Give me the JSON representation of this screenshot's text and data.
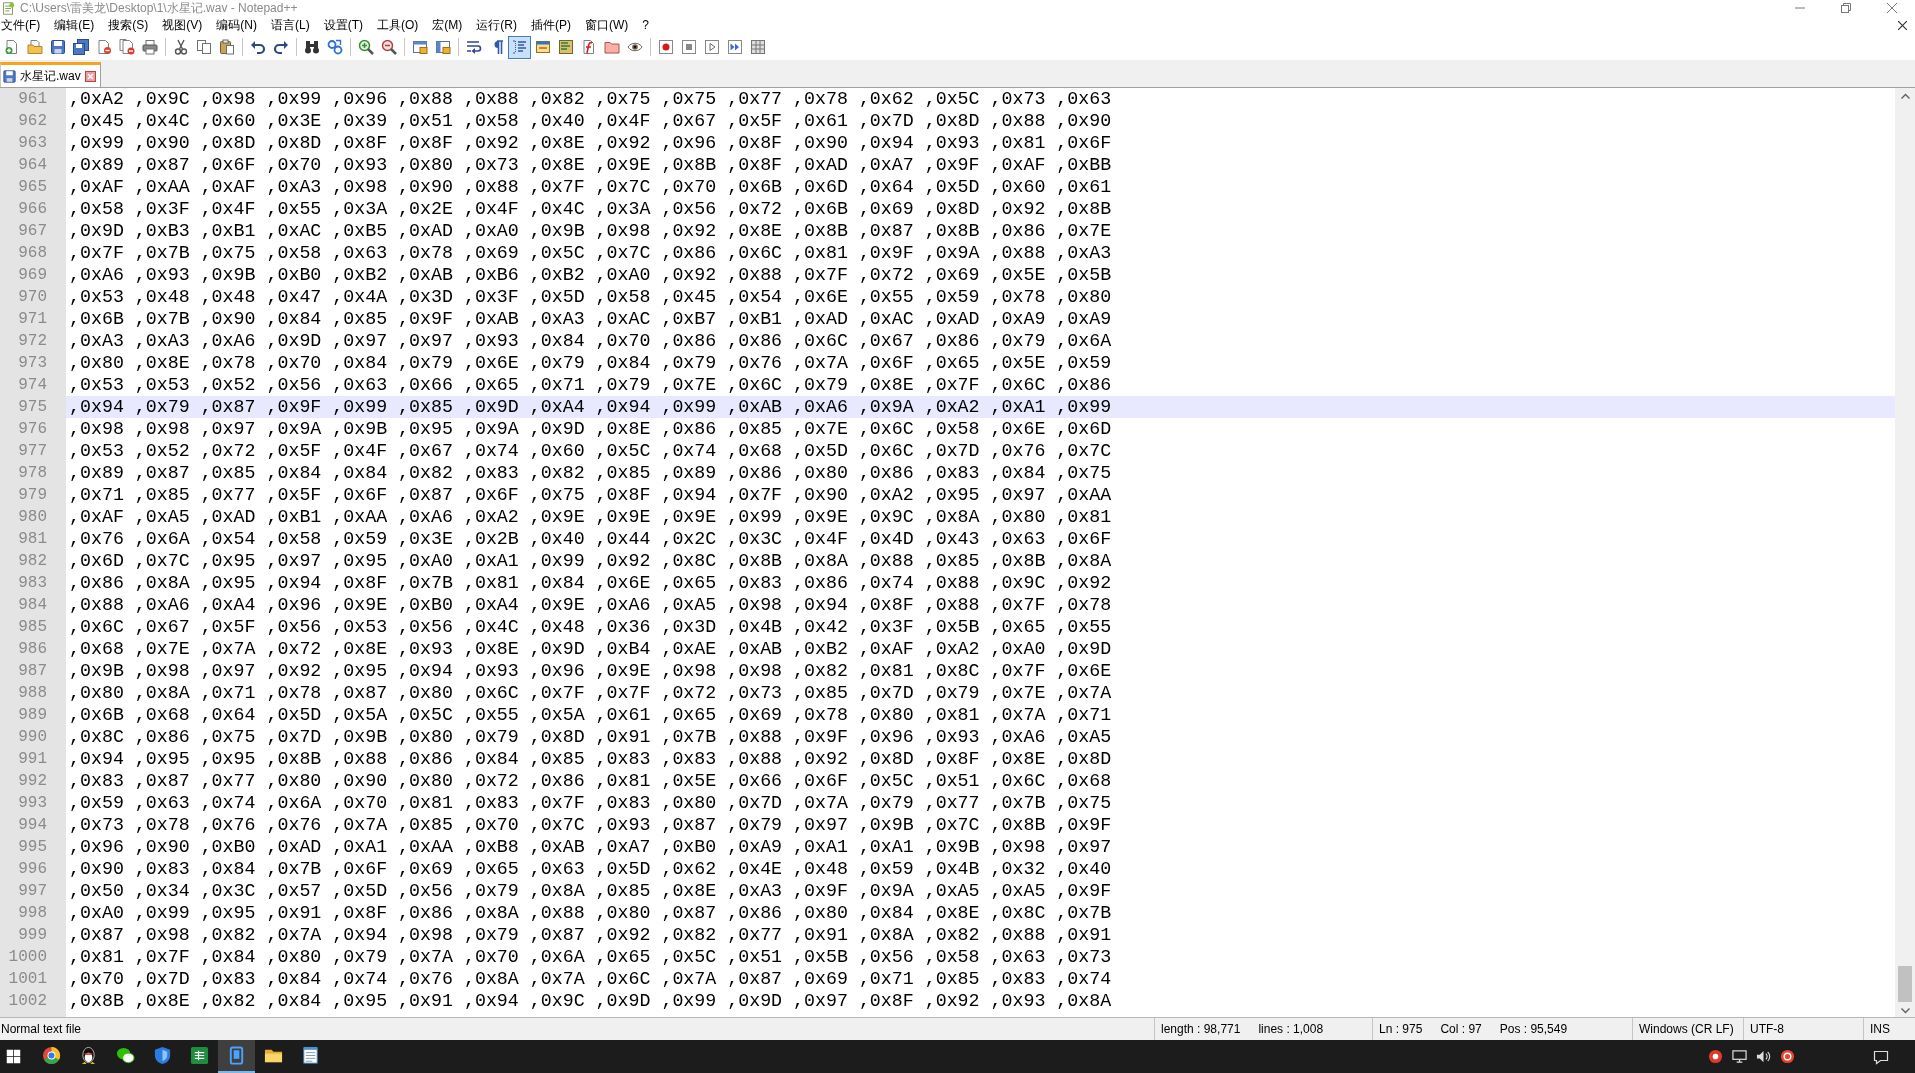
{
  "window": {
    "title": "C:\\Users\\雷美龙\\Desktop\\1\\水星记.wav - Notepad++"
  },
  "menu": [
    "文件(F)",
    "编辑(E)",
    "搜索(S)",
    "视图(V)",
    "编码(N)",
    "语言(L)",
    "设置(T)",
    "工具(O)",
    "宏(M)",
    "运行(R)",
    "插件(P)",
    "窗口(W)",
    "?"
  ],
  "toolbar": [
    [
      {
        "kind": "new",
        "on": false
      },
      {
        "kind": "open",
        "on": false
      },
      {
        "kind": "save",
        "on": false
      },
      {
        "kind": "saveall",
        "on": false
      },
      {
        "kind": "close",
        "on": false
      },
      {
        "kind": "closeall",
        "on": false
      },
      {
        "kind": "print",
        "on": false
      }
    ],
    [
      {
        "kind": "cut",
        "on": false
      },
      {
        "kind": "copy",
        "on": false
      },
      {
        "kind": "paste",
        "on": false
      }
    ],
    [
      {
        "kind": "undo",
        "on": false
      },
      {
        "kind": "redo",
        "on": false
      }
    ],
    [
      {
        "kind": "find",
        "on": false
      },
      {
        "kind": "replace",
        "on": false
      }
    ],
    [
      {
        "kind": "zoomin",
        "on": false
      },
      {
        "kind": "zoomout",
        "on": false
      }
    ],
    [
      {
        "kind": "syncv",
        "on": false
      },
      {
        "kind": "synch",
        "on": false
      }
    ],
    [
      {
        "kind": "wrap",
        "on": false
      },
      {
        "kind": "allchars",
        "on": false
      },
      {
        "kind": "indent",
        "on": true
      },
      {
        "kind": "udl",
        "on": false
      },
      {
        "kind": "docmap",
        "on": false
      },
      {
        "kind": "funclist",
        "on": false
      },
      {
        "kind": "workspace",
        "on": false
      },
      {
        "kind": "monitor",
        "on": false
      }
    ],
    [
      {
        "kind": "record",
        "on": false
      },
      {
        "kind": "stop",
        "on": false
      },
      {
        "kind": "play",
        "on": false
      },
      {
        "kind": "playmulti",
        "on": false
      },
      {
        "kind": "savemacro",
        "on": false
      }
    ]
  ],
  "tabs": [
    {
      "label": "水星记.wav",
      "selected": true
    }
  ],
  "editor": {
    "lines": [
      {
        "number": "961",
        "text": ",0xA2 ,0x9C ,0x98 ,0x99 ,0x96 ,0x88 ,0x88 ,0x82 ,0x75 ,0x75 ,0x77 ,0x78 ,0x62 ,0x5C ,0x73 ,0x63",
        "selected": false
      },
      {
        "number": "962",
        "text": ",0x45 ,0x4C ,0x60 ,0x3E ,0x39 ,0x51 ,0x58 ,0x40 ,0x4F ,0x67 ,0x5F ,0x61 ,0x7D ,0x8D ,0x88 ,0x90",
        "selected": false
      },
      {
        "number": "963",
        "text": ",0x99 ,0x90 ,0x8D ,0x8D ,0x8F ,0x8F ,0x92 ,0x8E ,0x92 ,0x96 ,0x8F ,0x90 ,0x94 ,0x93 ,0x81 ,0x6F",
        "selected": false
      },
      {
        "number": "964",
        "text": ",0x89 ,0x87 ,0x6F ,0x70 ,0x93 ,0x80 ,0x73 ,0x8E ,0x9E ,0x8B ,0x8F ,0xAD ,0xA7 ,0x9F ,0xAF ,0xBB",
        "selected": false
      },
      {
        "number": "965",
        "text": ",0xAF ,0xAA ,0xAF ,0xA3 ,0x98 ,0x90 ,0x88 ,0x7F ,0x7C ,0x70 ,0x6B ,0x6D ,0x64 ,0x5D ,0x60 ,0x61",
        "selected": false
      },
      {
        "number": "966",
        "text": ",0x58 ,0x3F ,0x4F ,0x55 ,0x3A ,0x2E ,0x4F ,0x4C ,0x3A ,0x56 ,0x72 ,0x6B ,0x69 ,0x8D ,0x92 ,0x8B",
        "selected": false
      },
      {
        "number": "967",
        "text": ",0x9D ,0xB3 ,0xB1 ,0xAC ,0xB5 ,0xAD ,0xA0 ,0x9B ,0x98 ,0x92 ,0x8E ,0x8B ,0x87 ,0x8B ,0x86 ,0x7E",
        "selected": false
      },
      {
        "number": "968",
        "text": ",0x7F ,0x7B ,0x75 ,0x58 ,0x63 ,0x78 ,0x69 ,0x5C ,0x7C ,0x86 ,0x6C ,0x81 ,0x9F ,0x9A ,0x88 ,0xA3",
        "selected": false
      },
      {
        "number": "969",
        "text": ",0xA6 ,0x93 ,0x9B ,0xB0 ,0xB2 ,0xAB ,0xB6 ,0xB2 ,0xA0 ,0x92 ,0x88 ,0x7F ,0x72 ,0x69 ,0x5E ,0x5B",
        "selected": false
      },
      {
        "number": "970",
        "text": ",0x53 ,0x48 ,0x48 ,0x47 ,0x4A ,0x3D ,0x3F ,0x5D ,0x58 ,0x45 ,0x54 ,0x6E ,0x55 ,0x59 ,0x78 ,0x80",
        "selected": false
      },
      {
        "number": "971",
        "text": ",0x6B ,0x7B ,0x90 ,0x84 ,0x85 ,0x9F ,0xAB ,0xA3 ,0xAC ,0xB7 ,0xB1 ,0xAD ,0xAC ,0xAD ,0xA9 ,0xA9",
        "selected": false
      },
      {
        "number": "972",
        "text": ",0xA3 ,0xA3 ,0xA6 ,0x9D ,0x97 ,0x97 ,0x93 ,0x84 ,0x70 ,0x86 ,0x86 ,0x6C ,0x67 ,0x86 ,0x79 ,0x6A",
        "selected": false
      },
      {
        "number": "973",
        "text": ",0x80 ,0x8E ,0x78 ,0x70 ,0x84 ,0x79 ,0x6E ,0x79 ,0x84 ,0x79 ,0x76 ,0x7A ,0x6F ,0x65 ,0x5E ,0x59",
        "selected": false
      },
      {
        "number": "974",
        "text": ",0x53 ,0x53 ,0x52 ,0x56 ,0x63 ,0x66 ,0x65 ,0x71 ,0x79 ,0x7E ,0x6C ,0x79 ,0x8E ,0x7F ,0x6C ,0x86",
        "selected": false
      },
      {
        "number": "975",
        "text": ",0x94 ,0x79 ,0x87 ,0x9F ,0x99 ,0x85 ,0x9D ,0xA4 ,0x94 ,0x99 ,0xAB ,0xA6 ,0x9A ,0xA2 ,0xA1 ,0x99",
        "selected": true
      },
      {
        "number": "976",
        "text": ",0x98 ,0x98 ,0x97 ,0x9A ,0x9B ,0x95 ,0x9A ,0x9D ,0x8E ,0x86 ,0x85 ,0x7E ,0x6C ,0x58 ,0x6E ,0x6D",
        "selected": false
      },
      {
        "number": "977",
        "text": ",0x53 ,0x52 ,0x72 ,0x5F ,0x4F ,0x67 ,0x74 ,0x60 ,0x5C ,0x74 ,0x68 ,0x5D ,0x6C ,0x7D ,0x76 ,0x7C",
        "selected": false
      },
      {
        "number": "978",
        "text": ",0x89 ,0x87 ,0x85 ,0x84 ,0x84 ,0x82 ,0x83 ,0x82 ,0x85 ,0x89 ,0x86 ,0x80 ,0x86 ,0x83 ,0x84 ,0x75",
        "selected": false
      },
      {
        "number": "979",
        "text": ",0x71 ,0x85 ,0x77 ,0x5F ,0x6F ,0x87 ,0x6F ,0x75 ,0x8F ,0x94 ,0x7F ,0x90 ,0xA2 ,0x95 ,0x97 ,0xAA",
        "selected": false
      },
      {
        "number": "980",
        "text": ",0xAF ,0xA5 ,0xAD ,0xB1 ,0xAA ,0xA6 ,0xA2 ,0x9E ,0x9E ,0x9E ,0x99 ,0x9E ,0x9C ,0x8A ,0x80 ,0x81",
        "selected": false
      },
      {
        "number": "981",
        "text": ",0x76 ,0x6A ,0x54 ,0x58 ,0x59 ,0x3E ,0x2B ,0x40 ,0x44 ,0x2C ,0x3C ,0x4F ,0x4D ,0x43 ,0x63 ,0x6F",
        "selected": false
      },
      {
        "number": "982",
        "text": ",0x6D ,0x7C ,0x95 ,0x97 ,0x95 ,0xA0 ,0xA1 ,0x99 ,0x92 ,0x8C ,0x8B ,0x8A ,0x88 ,0x85 ,0x8B ,0x8A",
        "selected": false
      },
      {
        "number": "983",
        "text": ",0x86 ,0x8A ,0x95 ,0x94 ,0x8F ,0x7B ,0x81 ,0x84 ,0x6E ,0x65 ,0x83 ,0x86 ,0x74 ,0x88 ,0x9C ,0x92",
        "selected": false
      },
      {
        "number": "984",
        "text": ",0x88 ,0xA6 ,0xA4 ,0x96 ,0x9E ,0xB0 ,0xA4 ,0x9E ,0xA6 ,0xA5 ,0x98 ,0x94 ,0x8F ,0x88 ,0x7F ,0x78",
        "selected": false
      },
      {
        "number": "985",
        "text": ",0x6C ,0x67 ,0x5F ,0x56 ,0x53 ,0x56 ,0x4C ,0x48 ,0x36 ,0x3D ,0x4B ,0x42 ,0x3F ,0x5B ,0x65 ,0x55",
        "selected": false
      },
      {
        "number": "986",
        "text": ",0x68 ,0x7E ,0x7A ,0x72 ,0x8E ,0x93 ,0x8E ,0x9D ,0xB4 ,0xAE ,0xAB ,0xB2 ,0xAF ,0xA2 ,0xA0 ,0x9D",
        "selected": false
      },
      {
        "number": "987",
        "text": ",0x9B ,0x98 ,0x97 ,0x92 ,0x95 ,0x94 ,0x93 ,0x96 ,0x9E ,0x98 ,0x98 ,0x82 ,0x81 ,0x8C ,0x7F ,0x6E",
        "selected": false
      },
      {
        "number": "988",
        "text": ",0x80 ,0x8A ,0x71 ,0x78 ,0x87 ,0x80 ,0x6C ,0x7F ,0x7F ,0x72 ,0x73 ,0x85 ,0x7D ,0x79 ,0x7E ,0x7A",
        "selected": false
      },
      {
        "number": "989",
        "text": ",0x6B ,0x68 ,0x64 ,0x5D ,0x5A ,0x5C ,0x55 ,0x5A ,0x61 ,0x65 ,0x69 ,0x78 ,0x80 ,0x81 ,0x7A ,0x71",
        "selected": false
      },
      {
        "number": "990",
        "text": ",0x8C ,0x86 ,0x75 ,0x7D ,0x9B ,0x80 ,0x79 ,0x8D ,0x91 ,0x7B ,0x88 ,0x9F ,0x96 ,0x93 ,0xA6 ,0xA5",
        "selected": false
      },
      {
        "number": "991",
        "text": ",0x94 ,0x95 ,0x95 ,0x8B ,0x88 ,0x86 ,0x84 ,0x85 ,0x83 ,0x83 ,0x88 ,0x92 ,0x8D ,0x8F ,0x8E ,0x8D",
        "selected": false
      },
      {
        "number": "992",
        "text": ",0x83 ,0x87 ,0x77 ,0x80 ,0x90 ,0x80 ,0x72 ,0x86 ,0x81 ,0x5E ,0x66 ,0x6F ,0x5C ,0x51 ,0x6C ,0x68",
        "selected": false
      },
      {
        "number": "993",
        "text": ",0x59 ,0x63 ,0x74 ,0x6A ,0x70 ,0x81 ,0x83 ,0x7F ,0x83 ,0x80 ,0x7D ,0x7A ,0x79 ,0x77 ,0x7B ,0x75",
        "selected": false
      },
      {
        "number": "994",
        "text": ",0x73 ,0x78 ,0x76 ,0x76 ,0x7A ,0x85 ,0x70 ,0x7C ,0x93 ,0x87 ,0x79 ,0x97 ,0x9B ,0x7C ,0x8B ,0x9F",
        "selected": false
      },
      {
        "number": "995",
        "text": ",0x96 ,0x90 ,0xB0 ,0xAD ,0xA1 ,0xAA ,0xB8 ,0xAB ,0xA7 ,0xB0 ,0xA9 ,0xA1 ,0xA1 ,0x9B ,0x98 ,0x97",
        "selected": false
      },
      {
        "number": "996",
        "text": ",0x90 ,0x83 ,0x84 ,0x7B ,0x6F ,0x69 ,0x65 ,0x63 ,0x5D ,0x62 ,0x4E ,0x48 ,0x59 ,0x4B ,0x32 ,0x40",
        "selected": false
      },
      {
        "number": "997",
        "text": ",0x50 ,0x34 ,0x3C ,0x57 ,0x5D ,0x56 ,0x79 ,0x8A ,0x85 ,0x8E ,0xA3 ,0x9F ,0x9A ,0xA5 ,0xA5 ,0x9F",
        "selected": false
      },
      {
        "number": "998",
        "text": ",0xA0 ,0x99 ,0x95 ,0x91 ,0x8F ,0x86 ,0x8A ,0x88 ,0x80 ,0x87 ,0x86 ,0x80 ,0x84 ,0x8E ,0x8C ,0x7B",
        "selected": false
      },
      {
        "number": "999",
        "text": ",0x87 ,0x98 ,0x82 ,0x7A ,0x94 ,0x98 ,0x79 ,0x87 ,0x92 ,0x82 ,0x77 ,0x91 ,0x8A ,0x82 ,0x88 ,0x91",
        "selected": false
      },
      {
        "number": "1000",
        "text": ",0x81 ,0x7F ,0x84 ,0x80 ,0x79 ,0x7A ,0x70 ,0x6A ,0x65 ,0x5C ,0x51 ,0x5B ,0x56 ,0x58 ,0x63 ,0x73",
        "selected": false
      },
      {
        "number": "1001",
        "text": ",0x70 ,0x7D ,0x83 ,0x84 ,0x74 ,0x76 ,0x8A ,0x7A ,0x6C ,0x7A ,0x87 ,0x69 ,0x71 ,0x85 ,0x83 ,0x74",
        "selected": false
      },
      {
        "number": "1002",
        "text": ",0x8B ,0x8E ,0x82 ,0x84 ,0x95 ,0x91 ,0x94 ,0x9C ,0x9D ,0x99 ,0x9D ,0x97 ,0x8F ,0x92 ,0x93 ,0x8A",
        "selected": false
      }
    ]
  },
  "status_bar": {
    "file_type": "Normal text file",
    "document": [
      "length : 98,771",
      "lines : 1,008"
    ],
    "position": [
      "Ln : 975",
      "Col : 97",
      "Pos : 95,549"
    ],
    "eol": "Windows (CR LF)",
    "encoding": "UTF-8",
    "mode": "INS"
  },
  "taskbar": {
    "apps": [
      {
        "kind": "round",
        "selected": false
      },
      {
        "kind": "penguin",
        "selected": false
      },
      {
        "kind": "chat",
        "selected": false
      },
      {
        "kind": "shield",
        "selected": false
      },
      {
        "kind": "grid",
        "selected": false
      },
      {
        "kind": "tablet",
        "selected": true
      },
      {
        "kind": "folder",
        "selected": false
      },
      {
        "kind": "notepad",
        "selected": false
      }
    ]
  }
}
